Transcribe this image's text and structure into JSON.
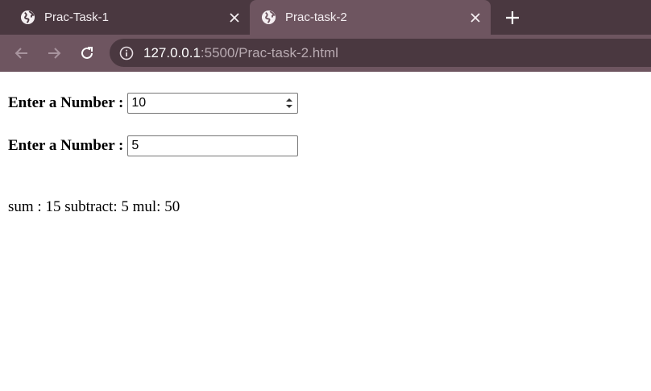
{
  "browser": {
    "tabs": [
      {
        "title": "Prac-Task-1",
        "active": false
      },
      {
        "title": "Prac-task-2",
        "active": true
      }
    ],
    "url_host": "127.0.0.1",
    "url_rest": ":5500/Prac-task-2.html",
    "colors": {
      "tabstrip": "#4a3840",
      "toolbar": "#6e5560"
    }
  },
  "form": {
    "first_label": "Enter a Number :",
    "first_value": "10",
    "second_label": "Enter a Number :",
    "second_value": "5"
  },
  "result_text": "sum : 15 subtract: 5 mul: 50"
}
